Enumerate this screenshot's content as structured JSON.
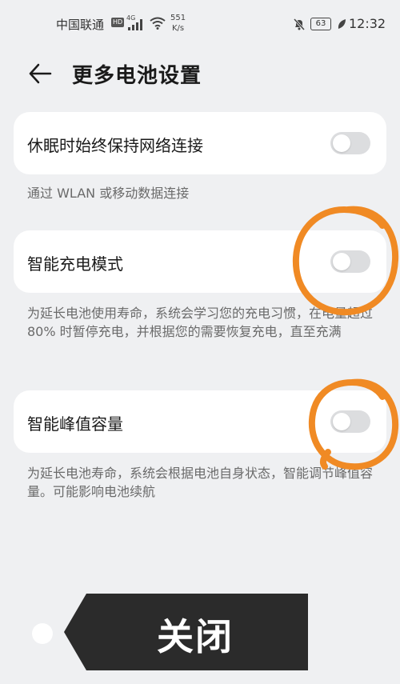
{
  "status_bar": {
    "carrier": "中国联通",
    "hd_badge": "HD",
    "network_type": "4G",
    "speed_value": "551",
    "speed_unit": "K/s",
    "battery": "63",
    "time": "12:32"
  },
  "header": {
    "title": "更多电池设置"
  },
  "settings": [
    {
      "label": "休眠时始终保持网络连接",
      "enabled": false,
      "description": "通过 WLAN 或移动数据连接"
    },
    {
      "label": "智能充电模式",
      "enabled": false,
      "description": "为延长电池使用寿命，系统会学习您的充电习惯，在电量超过 80% 时暂停充电，并根据您的需要恢复充电，直至充满"
    },
    {
      "label": "智能峰值容量",
      "enabled": false,
      "description": "为延长电池寿命，系统会根据电池自身状态，智能调节峰值容量。可能影响电池续航"
    }
  ],
  "overlay": {
    "banner_text": "关闭"
  },
  "colors": {
    "background": "#eff0f2",
    "card": "#ffffff",
    "toggle_off": "#dcdddf",
    "annotation": "#f08a24",
    "banner": "#2b2b2b"
  }
}
